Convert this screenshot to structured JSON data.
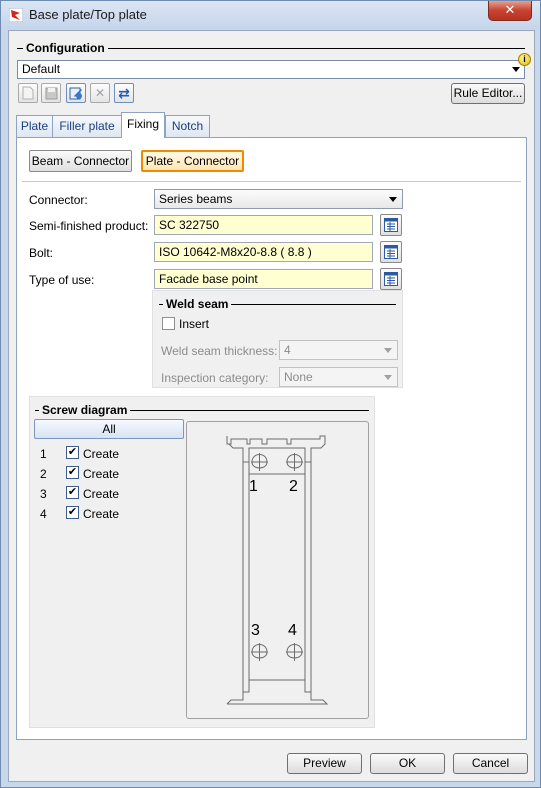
{
  "window": {
    "title": "Base plate/Top plate",
    "close": "✕"
  },
  "configuration": {
    "title": "Configuration",
    "selected": "Default",
    "rule_editor": "Rule Editor..."
  },
  "tabs": [
    {
      "label": "Plate"
    },
    {
      "label": "Filler plate"
    },
    {
      "label": "Fixing"
    },
    {
      "label": "Notch"
    }
  ],
  "connector_buttons": {
    "beam": "Beam - Connector",
    "plate": "Plate - Connector"
  },
  "form": {
    "connector": {
      "label": "Connector:",
      "value": "Series beams"
    },
    "semi_finished": {
      "label": "Semi-finished product:",
      "value": "SC  322750"
    },
    "bolt": {
      "label": "Bolt:",
      "value": "ISO 10642-M8x20-8.8  ( 8.8 )"
    },
    "type_of_use": {
      "label": "Type of use:",
      "value": "Facade base point"
    }
  },
  "weld_seam": {
    "title": "Weld seam",
    "insert_label": "Insert",
    "insert_checked": false,
    "thickness_label": "Weld seam thickness:",
    "thickness_value": "4",
    "inspection_label": "Inspection category:",
    "inspection_value": "None"
  },
  "screw_diagram": {
    "title": "Screw diagram",
    "all_label": "All",
    "rows": [
      {
        "num": "1",
        "label": "Create",
        "checked": true
      },
      {
        "num": "2",
        "label": "Create",
        "checked": true
      },
      {
        "num": "3",
        "label": "Create",
        "checked": true
      },
      {
        "num": "4",
        "label": "Create",
        "checked": true
      }
    ],
    "marks": [
      "1",
      "2",
      "3",
      "4"
    ]
  },
  "footer": {
    "preview": "Preview",
    "ok": "OK",
    "cancel": "Cancel"
  },
  "colors": {
    "accent_border": "#f08b00",
    "field_bg": "#ffffd2",
    "close_red": "#c7432f"
  }
}
